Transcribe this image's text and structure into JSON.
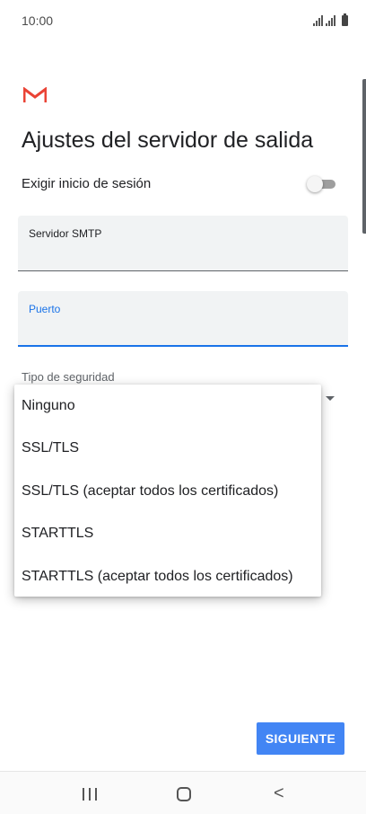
{
  "status_bar": {
    "time": "10:00"
  },
  "colors": {
    "accent": "#1a73e8",
    "button": "#4285f4",
    "gmail_red": "#ea4335"
  },
  "header": {
    "logo_icon": "gmail-logo-icon",
    "title": "Ajustes del servidor de salida"
  },
  "login": {
    "label": "Exigir inicio de sesión",
    "enabled": false
  },
  "fields": {
    "smtp": {
      "label": "Servidor SMTP",
      "value": ""
    },
    "port": {
      "label": "Puerto",
      "value": ""
    }
  },
  "security": {
    "label": "Tipo de seguridad",
    "options": [
      "Ninguno",
      "SSL/TLS",
      "SSL/TLS (aceptar todos los certificados)",
      "STARTTLS",
      "STARTTLS (aceptar todos los certificados)"
    ]
  },
  "actions": {
    "next_label": "SIGUIENTE"
  },
  "nav": {
    "recents_icon": "recents-icon",
    "home_icon": "home-icon",
    "back_icon": "back-icon",
    "back_glyph": "<"
  }
}
